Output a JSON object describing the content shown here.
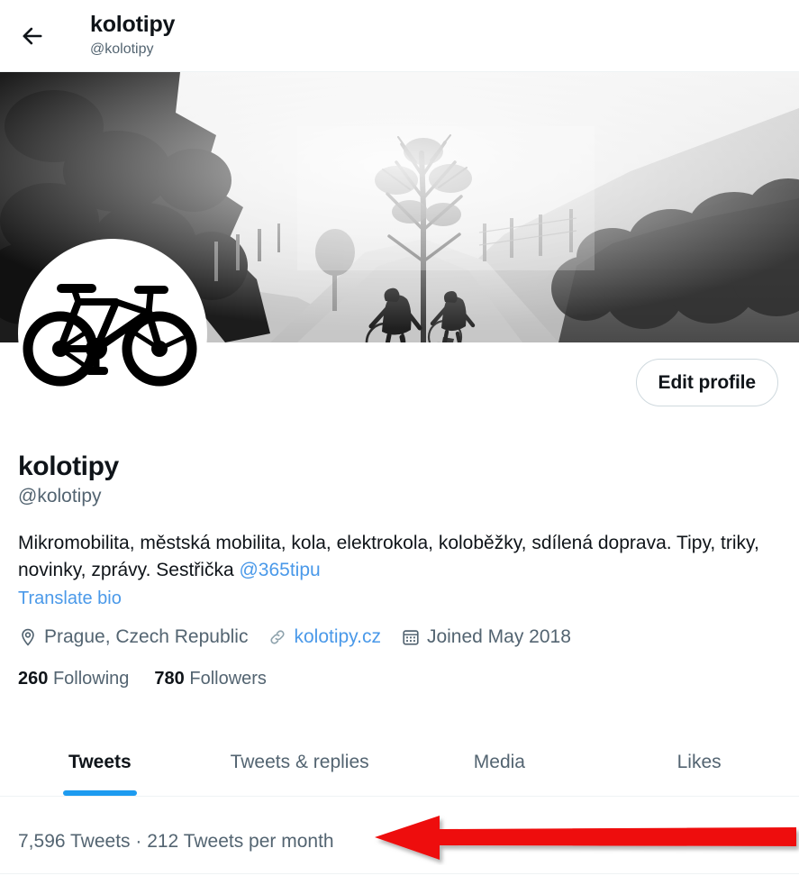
{
  "header": {
    "back_icon": "arrow-left-icon",
    "name": "kolotipy",
    "handle": "@kolotipy"
  },
  "banner": {
    "alt": "Black and white photo of two cyclists riding on a misty dirt country road",
    "icon": "banner-photo"
  },
  "avatar": {
    "icon": "bicycle-icon",
    "alt": "Bicycle silhouette profile picture"
  },
  "actions": {
    "edit_profile_label": "Edit profile"
  },
  "profile": {
    "display_name": "kolotipy",
    "handle": "@kolotipy",
    "bio_part1": "Mikromobilita, městská mobilita, kola, elektrokola, koloběžky, sdílená doprava. Tipy, triky, novinky, zprávy. Sestřička ",
    "bio_mention": "@365tipu",
    "translate_bio_label": "Translate bio",
    "location": "Prague, Czech Republic",
    "location_icon": "location-pin-icon",
    "website": "kolotipy.cz",
    "website_icon": "link-chain-icon",
    "joined": "Joined May 2018",
    "joined_icon": "calendar-icon",
    "following_count": "260",
    "following_label": "Following",
    "followers_count": "780",
    "followers_label": "Followers"
  },
  "tabs": [
    {
      "label": "Tweets",
      "active": true
    },
    {
      "label": "Tweets & replies",
      "active": false
    },
    {
      "label": "Media",
      "active": false
    },
    {
      "label": "Likes",
      "active": false
    }
  ],
  "tweet_stats": {
    "text": "7,596 Tweets · 212 Tweets per month"
  },
  "annotation": {
    "type": "arrow-left",
    "color": "#EE1111"
  },
  "colors": {
    "accent_blue": "#1D9BF0",
    "link_blue": "#4A99E9",
    "text_primary": "#0F1419",
    "text_secondary": "#536471",
    "border": "#EFF3F4",
    "annotation_red": "#EE1111"
  }
}
